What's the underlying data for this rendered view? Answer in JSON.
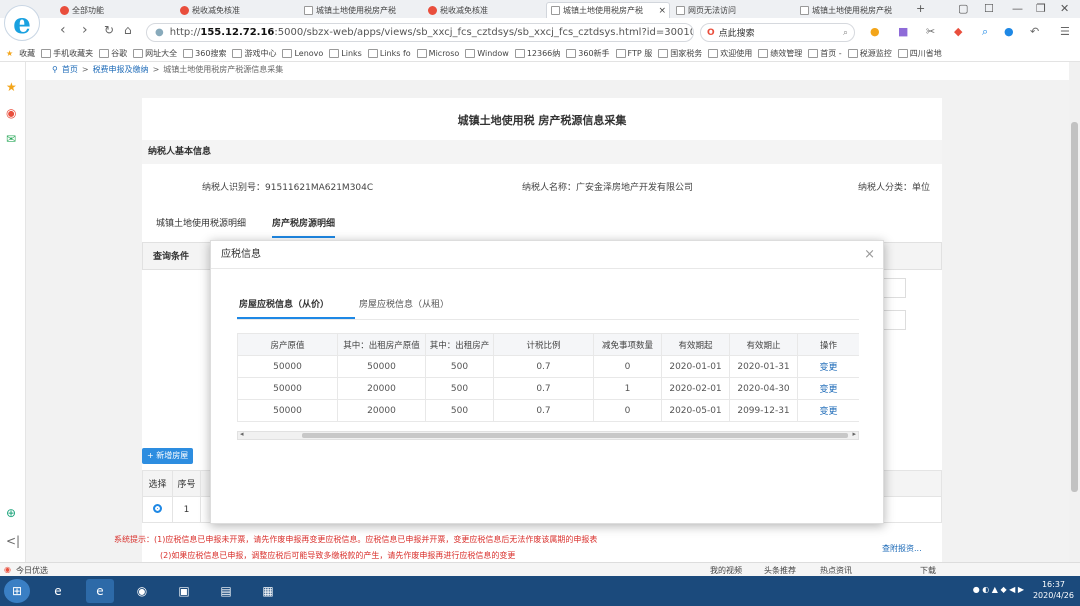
{
  "browser": {
    "tabs": [
      {
        "label": "全部功能"
      },
      {
        "label": "税收减免核准"
      },
      {
        "label": "城镇土地使用税房产税"
      },
      {
        "label": "税收减免核准"
      },
      {
        "label": "城镇土地使用税房产税"
      },
      {
        "label": "网页无法访问"
      },
      {
        "label": "城镇土地使用税房产税"
      }
    ],
    "url_host": "155.12.72.16",
    "url_rest": ":5000/sbzx-web/apps/views/sb_xxcj_fcs_cztdsys/sb_xxcj_fcs_cztdsys.html?id=30010",
    "url_prefix": "http://",
    "search_placeholder": "点此搜索",
    "bookmarks": [
      "收藏",
      "手机收藏夹",
      "谷歌",
      "网址大全",
      "360搜索",
      "游戏中心",
      "Lenovo",
      "Links",
      "Links fo",
      "Microso",
      "Window",
      "12366纳",
      "360新手",
      "FTP 服",
      "国家税务",
      "欢迎使用",
      "绩效管理",
      "首页 -",
      "税源监控",
      "四川省地"
    ]
  },
  "breadcrumb": {
    "home": "首页",
    "level1": "税费申报及缴纳",
    "level2": "城镇土地使用税房产税源信息采集"
  },
  "page": {
    "title": "城镇土地使用税 房产税源信息采集",
    "section_basic": "纳税人基本信息",
    "taxpayer_id_label": "纳税人识别号：",
    "taxpayer_id": "91511621MA621M304C",
    "taxpayer_name_label": "纳税人名称：",
    "taxpayer_name": "广安金泽房地产开发有限公司",
    "taxpayer_type_label": "纳税人分类：",
    "taxpayer_type": "单位",
    "subtab_land": "城镇土地使用税源明细",
    "subtab_house": "房产税房源明细",
    "query_label": "查询条件",
    "add_button": "+ 新增房屋",
    "table_headers": [
      "选择",
      "序号"
    ],
    "row_index": "1",
    "attach_link": "查附报资...",
    "sys_note1": "系统提示：(1)应税信息已申报未开票，请先作废申报再变更应税信息。应税信息已申报并开票，变更应税信息后无法作废该属期的申报表",
    "sys_note2": "(2)如果应税信息已申报，调整应税后可能导致多缴税款的产生，请先作废申报再进行应税信息的变更"
  },
  "modal": {
    "title": "应税信息",
    "tab_active": "房屋应税信息（从价）",
    "tab_other": "房屋应税信息（从租）",
    "columns": [
      "房产原值",
      "其中：出租房产原值",
      "其中：出租房产",
      "计税比例",
      "减免事项数量",
      "有效期起",
      "有效期止",
      "操作"
    ],
    "rows": [
      [
        "50000",
        "50000",
        "500",
        "0.7",
        "0",
        "2020-01-01",
        "2020-01-31",
        "变更"
      ],
      [
        "50000",
        "20000",
        "500",
        "0.7",
        "1",
        "2020-02-01",
        "2020-04-30",
        "变更"
      ],
      [
        "50000",
        "20000",
        "500",
        "0.7",
        "0",
        "2020-05-01",
        "2099-12-31",
        "变更"
      ]
    ]
  },
  "statusbar": {
    "left": "今日优选",
    "items": [
      "我的视频",
      "头条推荐",
      "热点资讯"
    ],
    "download": "下载"
  },
  "clock": {
    "time": "16:37",
    "date": "2020/4/26"
  },
  "colors": {
    "accent": "#1e88e5",
    "link": "#1e6bb8",
    "warning": "#d9302c"
  }
}
